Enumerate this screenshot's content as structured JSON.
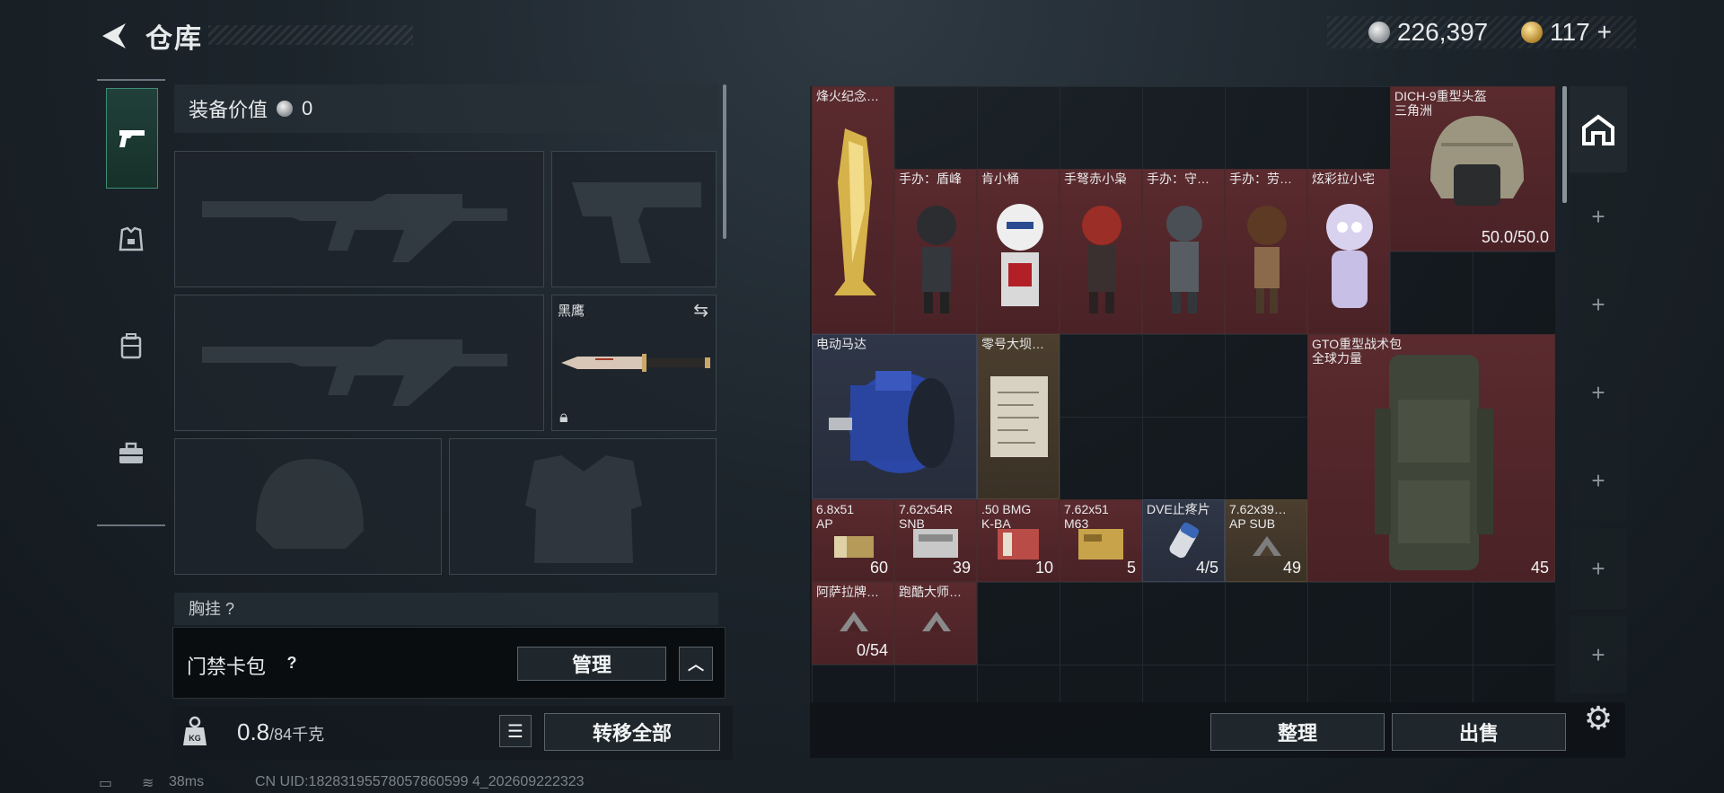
{
  "header": {
    "title": "仓库"
  },
  "currency": {
    "silver": "226,397",
    "gold": "117",
    "gold_plus": "+"
  },
  "nav": {
    "items": [
      "pistol-icon",
      "armor-icon",
      "backpack-icon",
      "briefcase-icon"
    ]
  },
  "loadout": {
    "equipment_value_label": "装备价值",
    "equipment_value": "0",
    "melee_label": "黑鹰",
    "chest_label": "胸挂 ?"
  },
  "card_pack": {
    "label": "门禁卡包",
    "question": "?",
    "manage_label": "管理"
  },
  "weight": {
    "current": "0.8",
    "max": "/84千克",
    "icon_text": "KG",
    "transfer_all_label": "转移全部"
  },
  "stash": {
    "items": [
      {
        "name": "烽火纪念…",
        "count": ""
      },
      {
        "name": "手办：盾峰",
        "count": ""
      },
      {
        "name": "肯小桶",
        "count": ""
      },
      {
        "name": "手弩赤小枭",
        "count": ""
      },
      {
        "name": "手办：守…",
        "count": ""
      },
      {
        "name": "手办：劳…",
        "count": ""
      },
      {
        "name": "炫彩拉小宅",
        "count": ""
      },
      {
        "name": "DICH-9重型头盔",
        "name2": "三角洲",
        "count": "50.0/50.0"
      },
      {
        "name": "电动马达",
        "count": ""
      },
      {
        "name": "零号大坝…",
        "count": ""
      },
      {
        "name": "GTO重型战术包",
        "name2": "全球力量",
        "count": "45"
      },
      {
        "name": "6.8x51",
        "name2": "AP",
        "count": "60"
      },
      {
        "name": "7.62x54R",
        "name2": "SNB",
        "count": "39"
      },
      {
        "name": ".50 BMG",
        "name2": "K-BA",
        "count": "10"
      },
      {
        "name": "7.62x51",
        "name2": "M63",
        "count": "5"
      },
      {
        "name": "DVE止疼片",
        "count": "4/5"
      },
      {
        "name": "7.62x39…",
        "name2": "AP SUB",
        "count": "49"
      },
      {
        "name": "阿萨拉牌…",
        "count": "0/54"
      },
      {
        "name": "跑酷大师…",
        "count": ""
      }
    ]
  },
  "actions": {
    "sort_label": "整理",
    "sell_label": "出售"
  },
  "status_bar": {
    "ping": "38ms",
    "uid": "CN UID:18283195578057860599 4_202609222323"
  },
  "colors": {
    "item_red": "#5a2a2e",
    "accent_green": "#3c8d74"
  }
}
